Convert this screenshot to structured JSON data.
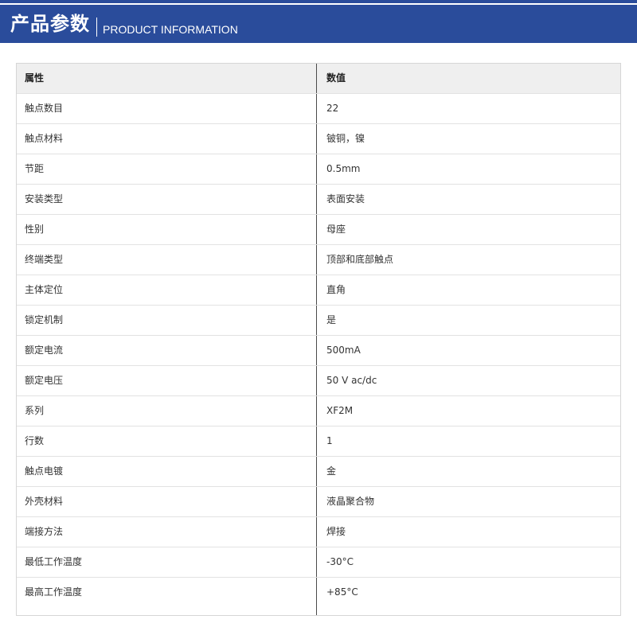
{
  "banner": {
    "title_cn": "产品参数",
    "title_en": "PRODUCT INFORMATION",
    "background": "#2a4c9b"
  },
  "table": {
    "header": {
      "attribute": "属性",
      "value": "数值"
    },
    "rows": [
      {
        "attribute": "触点数目",
        "value": "22"
      },
      {
        "attribute": "触点材料",
        "value": "铍铜，镍"
      },
      {
        "attribute": "节距",
        "value": "0.5mm"
      },
      {
        "attribute": "安装类型",
        "value": "表面安装"
      },
      {
        "attribute": "性别",
        "value": "母座"
      },
      {
        "attribute": "终端类型",
        "value": "顶部和底部触点"
      },
      {
        "attribute": "主体定位",
        "value": "直角"
      },
      {
        "attribute": "锁定机制",
        "value": "是"
      },
      {
        "attribute": "额定电流",
        "value": "500mA"
      },
      {
        "attribute": "额定电压",
        "value": "50 V ac/dc"
      },
      {
        "attribute": "系列",
        "value": "XF2M"
      },
      {
        "attribute": "行数",
        "value": "1"
      },
      {
        "attribute": "触点电镀",
        "value": "金"
      },
      {
        "attribute": "外壳材料",
        "value": "液晶聚合物"
      },
      {
        "attribute": "端接方法",
        "value": "焊接"
      },
      {
        "attribute": "最低工作温度",
        "value": "-30°C"
      },
      {
        "attribute": "最高工作温度",
        "value": "+85°C"
      }
    ]
  }
}
